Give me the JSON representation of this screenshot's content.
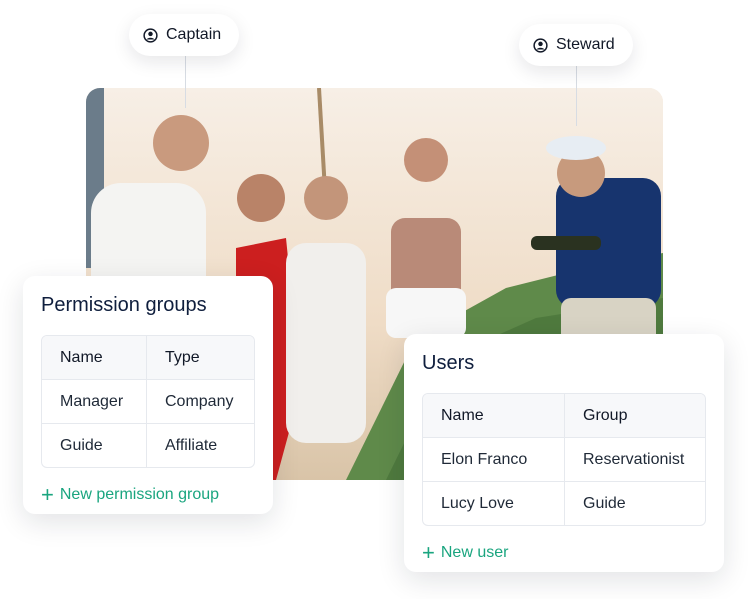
{
  "tags": {
    "captain": {
      "label": "Captain",
      "icon": "user-circle-icon"
    },
    "steward": {
      "label": "Steward",
      "icon": "user-circle-icon"
    }
  },
  "photo": {
    "description": "People celebrating with champagne on a sailboat at sunset"
  },
  "permission_groups": {
    "title": "Permission groups",
    "columns": [
      "Name",
      "Type"
    ],
    "rows": [
      [
        "Manager",
        "Company"
      ],
      [
        "Guide",
        "Affiliate"
      ]
    ],
    "add_label": "New permission group",
    "add_icon": "plus-icon"
  },
  "users": {
    "title": "Users",
    "columns": [
      "Name",
      "Group"
    ],
    "rows": [
      [
        "Elon Franco",
        "Reservationist"
      ],
      [
        "Lucy Love",
        "Guide"
      ]
    ],
    "add_label": "New user",
    "add_icon": "plus-icon"
  },
  "colors": {
    "accent": "#1aa57f",
    "title": "#0f1e3d",
    "border": "#e6e9ee"
  }
}
